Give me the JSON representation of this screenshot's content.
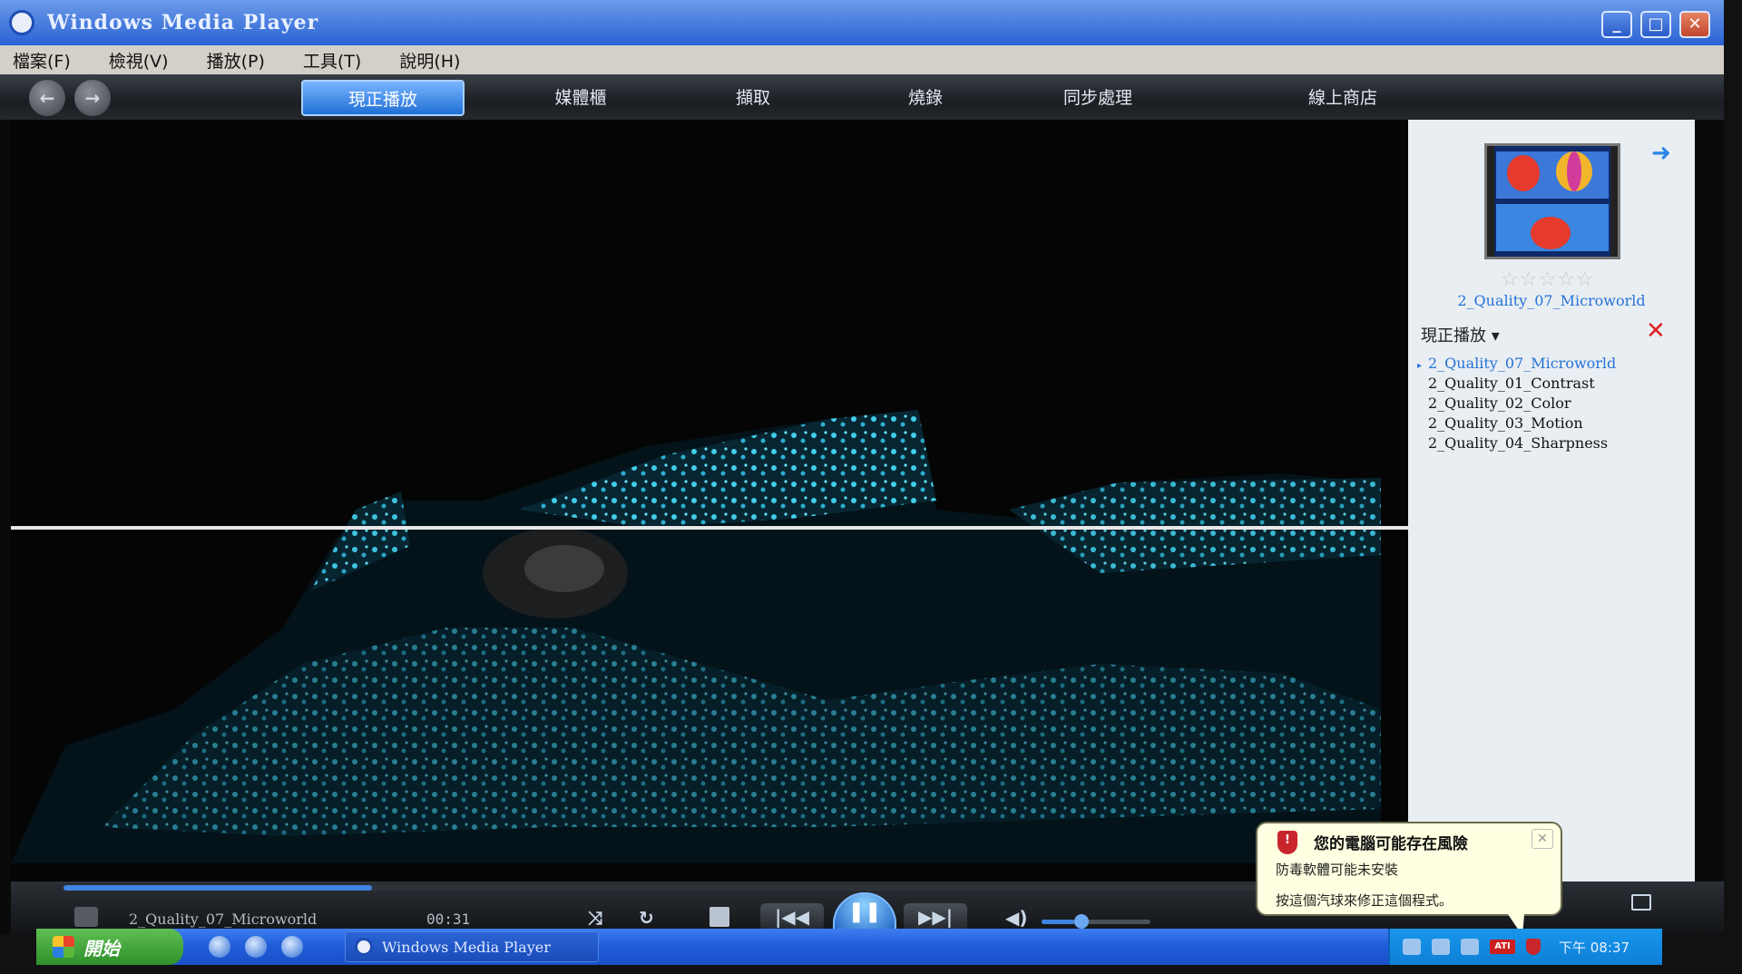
{
  "window": {
    "title": "Windows Media Player",
    "controls": {
      "minimize": "_",
      "maximize": "□",
      "close": "✕"
    }
  },
  "menubar": {
    "items": [
      {
        "label": "檔案(F)"
      },
      {
        "label": "檢視(V)"
      },
      {
        "label": "播放(P)"
      },
      {
        "label": "工具(T)"
      },
      {
        "label": "說明(H)"
      }
    ]
  },
  "navbar": {
    "back_icon": "back-arrow-icon",
    "forward_icon": "forward-arrow-icon",
    "tabs": [
      {
        "label": "現正播放",
        "active": true
      },
      {
        "label": "媒體櫃",
        "active": false
      },
      {
        "label": "擷取",
        "active": false
      },
      {
        "label": "燒錄",
        "active": false
      },
      {
        "label": "同步處理",
        "active": false
      },
      {
        "label": "線上商店",
        "active": false
      }
    ]
  },
  "sidebar": {
    "now_playing_title": "2_Quality_07_Microworld",
    "rating": "☆☆☆☆☆",
    "playlist_header": "現正播放 ▾",
    "playlist": [
      {
        "label": "2_Quality_07_Microworld",
        "current": true
      },
      {
        "label": "2_Quality_01_Contrast",
        "current": false
      },
      {
        "label": "2_Quality_02_Color",
        "current": false
      },
      {
        "label": "2_Quality_03_Motion",
        "current": false
      },
      {
        "label": "2_Quality_04_Sharpness",
        "current": false
      }
    ]
  },
  "controls": {
    "track_name": "2_Quality_07_Microworld",
    "track_time": "00:31",
    "seek_progress": 0.23,
    "volume_level": 0.3,
    "play_state": "playing",
    "icons": {
      "shuffle": "shuffle-icon",
      "repeat": "repeat-icon",
      "stop": "stop-icon",
      "prev": "previous-icon",
      "pause": "pause-icon",
      "next": "next-icon",
      "mute": "speaker-icon",
      "mini": "mini-mode-icon"
    }
  },
  "balloon": {
    "title": "您的電腦可能存在風險",
    "line1": "防毒軟體可能未安裝",
    "line2": "按這個汽球來修正這個程式。"
  },
  "taskbar": {
    "start_label": "開始",
    "task_label": "Windows Media Player",
    "clock": "下午 08:37"
  },
  "colors": {
    "titlebar": "#2b62d4",
    "accent": "#3f84e0",
    "video_glow": "#3fd0f0",
    "sidebar_bg": "#e9eef2",
    "balloon_bg": "#ffffe1"
  }
}
